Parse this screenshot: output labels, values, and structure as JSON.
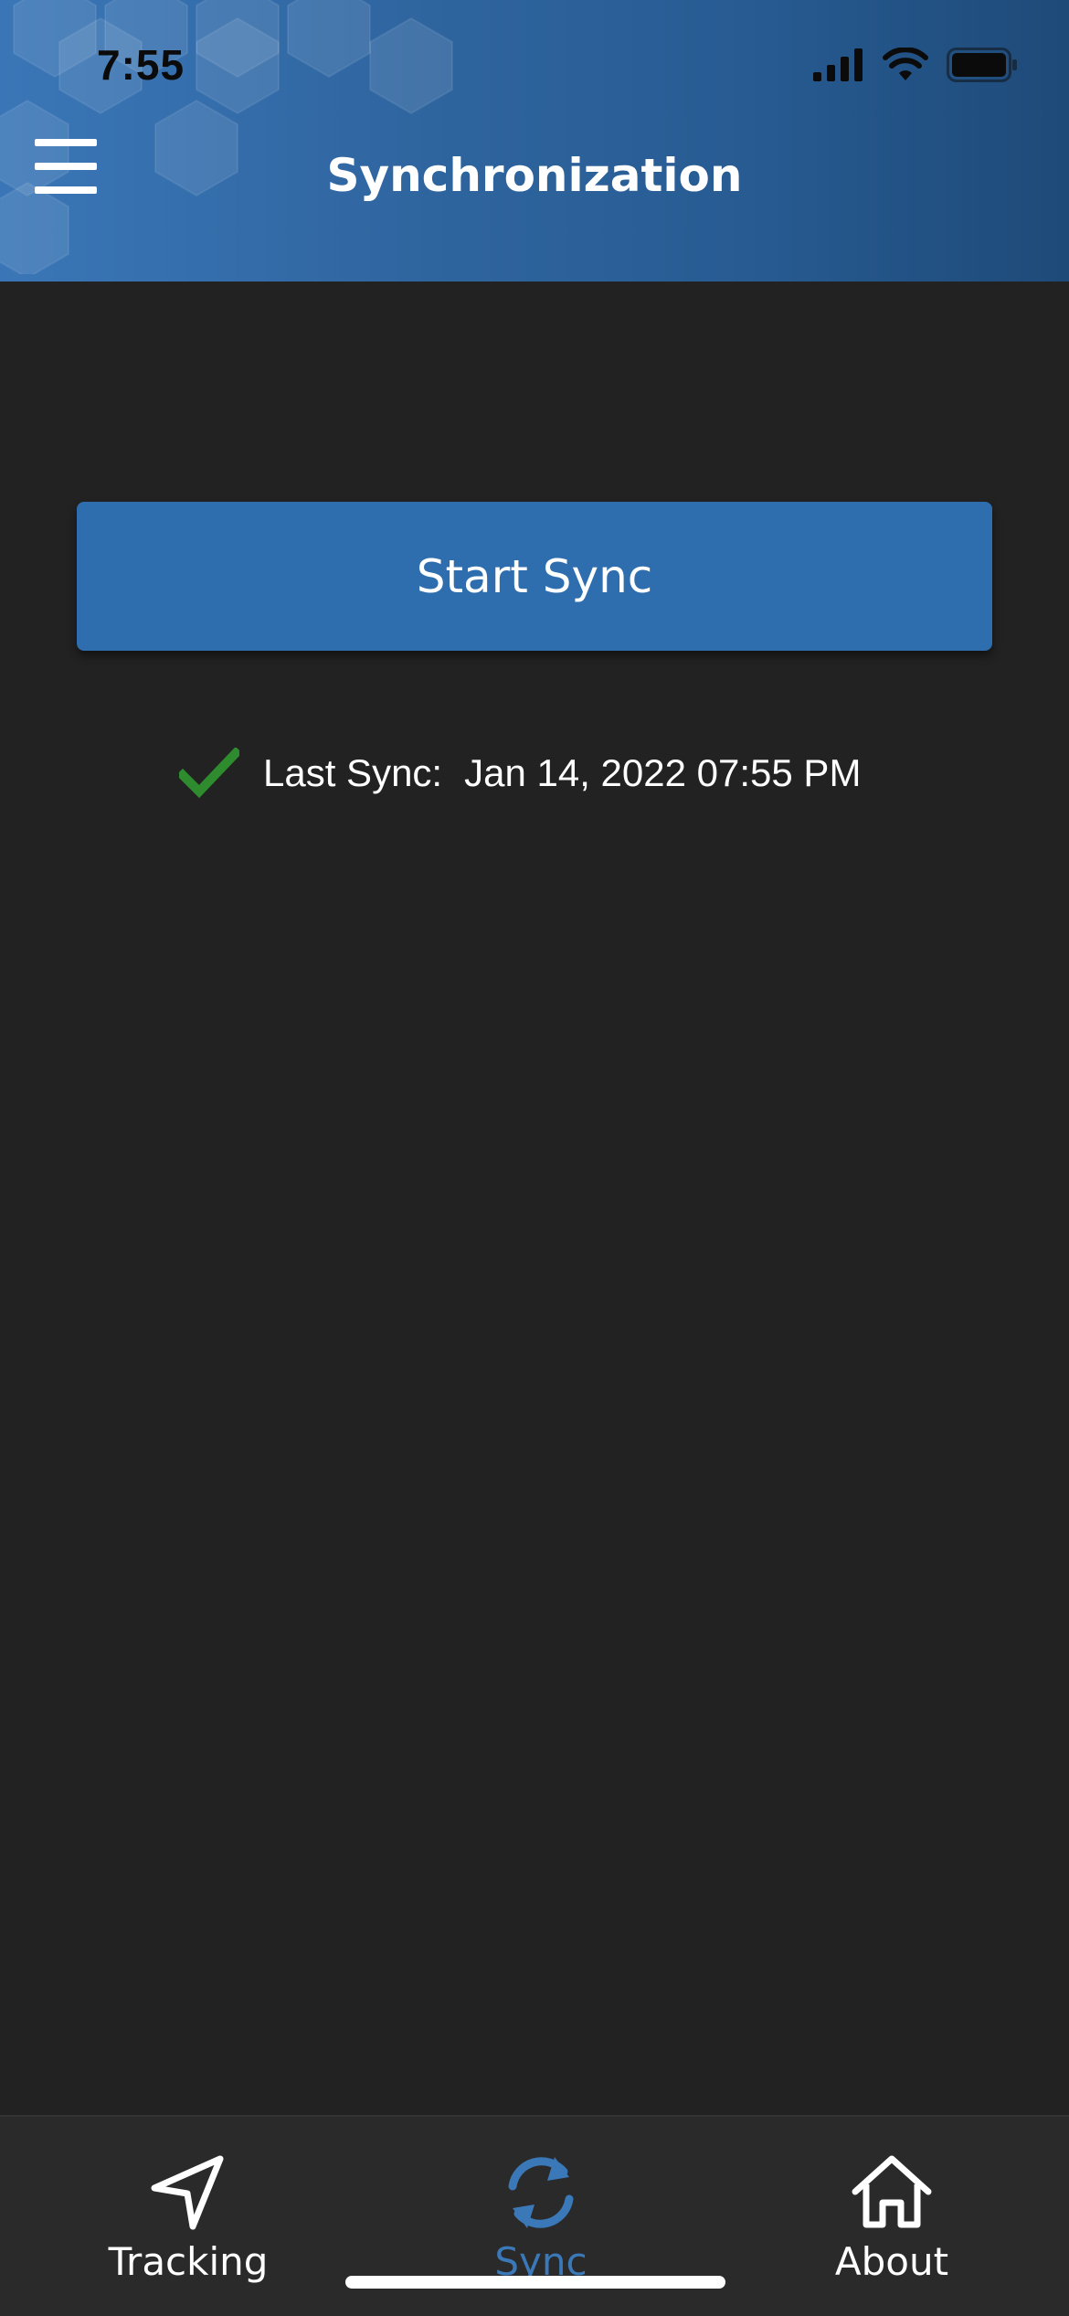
{
  "status_bar": {
    "time": "7:55"
  },
  "header": {
    "title": "Synchronization"
  },
  "main": {
    "start_sync_label": "Start Sync",
    "last_sync_label": "Last Sync:",
    "last_sync_value": "Jan 14, 2022 07:55 PM"
  },
  "tabs": [
    {
      "label": "Tracking",
      "icon": "navigation-arrow-icon",
      "active": false
    },
    {
      "label": "Sync",
      "icon": "sync-icon",
      "active": true
    },
    {
      "label": "About",
      "icon": "home-icon",
      "active": false
    }
  ],
  "colors": {
    "background": "#222222",
    "header": "#2f659f",
    "accent": "#2f6eae",
    "success": "#2e8b2e",
    "tabbar": "#2a2a2a"
  }
}
